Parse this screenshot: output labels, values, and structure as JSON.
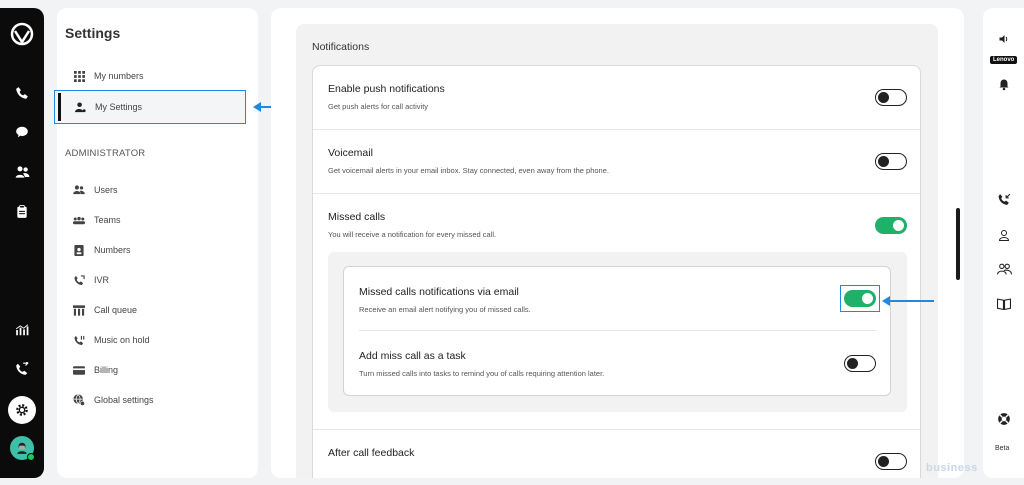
{
  "nav": {
    "title": "Settings",
    "items": [
      {
        "label": "My numbers"
      },
      {
        "label": "My Settings"
      }
    ],
    "admin_heading": "ADMINISTRATOR",
    "admin_items": [
      {
        "label": "Users"
      },
      {
        "label": "Teams"
      },
      {
        "label": "Numbers"
      },
      {
        "label": "IVR"
      },
      {
        "label": "Call queue"
      },
      {
        "label": "Music on hold"
      },
      {
        "label": "Billing"
      },
      {
        "label": "Global settings"
      }
    ]
  },
  "notifications": {
    "title": "Notifications",
    "rows": [
      {
        "title": "Enable push notifications",
        "desc": "Get push alerts for call activity",
        "enabled": false
      },
      {
        "title": "Voicemail",
        "desc": "Get voicemail alerts in your email inbox. Stay connected, even away from the phone.",
        "enabled": false
      },
      {
        "title": "Missed calls",
        "desc": "You will receive a notification for every missed call.",
        "enabled": true
      }
    ],
    "missed_sub": [
      {
        "title": "Missed calls notifications via email",
        "desc": "Receive an email alert notifying you of missed calls.",
        "enabled": true
      },
      {
        "title": "Add miss call as a task",
        "desc": "Turn missed calls into tasks to remind you of calls requiring attention later.",
        "enabled": false
      }
    ],
    "after": {
      "title": "After call feedback",
      "enabled": false
    }
  },
  "right_rail": {
    "brand": "Lenovo",
    "beta": "Beta"
  },
  "watermark": "business",
  "colors": {
    "accent": "#1e88e5",
    "toggle_on": "#1fb06a",
    "rail": "#0b0b0b"
  }
}
